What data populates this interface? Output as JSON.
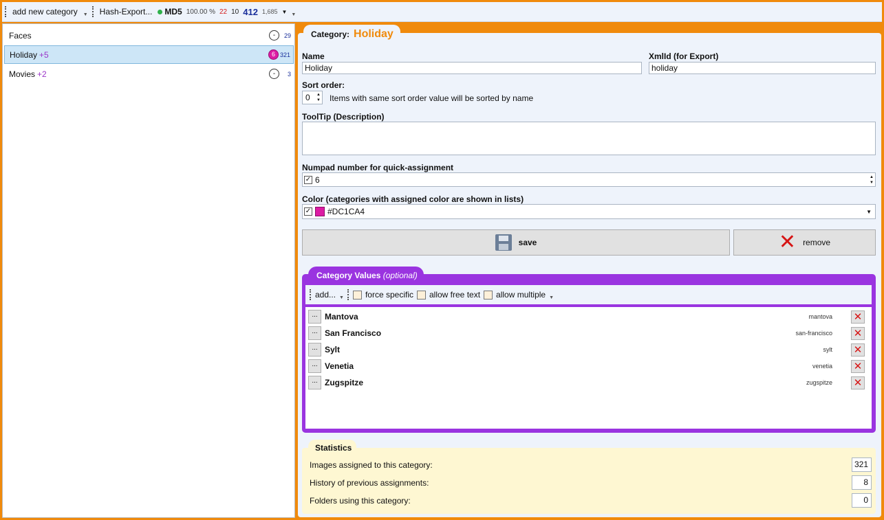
{
  "toolbar": {
    "add_category": "add new category",
    "hash_export": "Hash-Export...",
    "md5_label": "MD5",
    "percent": "100.00 %",
    "count_red": "22",
    "count_dark": "10",
    "count_blue": "412",
    "count_total": "1,685"
  },
  "categories": [
    {
      "name": "Faces",
      "plus": "",
      "badge": "-",
      "count": "29"
    },
    {
      "name": "Holiday",
      "plus": "+5",
      "badge": "6",
      "count": "321"
    },
    {
      "name": "Movies",
      "plus": "+2",
      "badge": "-",
      "count": "3"
    }
  ],
  "editor": {
    "tab_label": "Category:",
    "tab_value": "Holiday",
    "name_label": "Name",
    "name_value": "Holiday",
    "xmlid_label": "XmlId (for Export)",
    "xmlid_value": "holiday",
    "sort_label": "Sort order:",
    "sort_value": "0",
    "sort_hint": "Items with same sort order value will be sorted by name",
    "tooltip_label": "ToolTip (Description)",
    "numpad_label": "Numpad number for quick-assignment",
    "numpad_value": "6",
    "color_label": "Color (categories with assigned color are shown in lists)",
    "color_value": "#DC1CA4",
    "save_label": "save",
    "remove_label": "remove"
  },
  "category_values": {
    "title": "Category Values",
    "title_note": "(optional)",
    "add_label": "add...",
    "force_specific": "force specific",
    "allow_free_text": "allow free text",
    "allow_multiple": "allow multiple",
    "items": [
      {
        "name": "Mantova",
        "xml": "mantova"
      },
      {
        "name": "San Francisco",
        "xml": "san-francisco"
      },
      {
        "name": "Sylt",
        "xml": "sylt"
      },
      {
        "name": "Venetia",
        "xml": "venetia"
      },
      {
        "name": "Zugspitze",
        "xml": "zugspitze"
      }
    ]
  },
  "statistics": {
    "title": "Statistics",
    "rows": [
      {
        "label": "Images assigned to this category:",
        "value": "321"
      },
      {
        "label": "History of previous assignments:",
        "value": "8"
      },
      {
        "label": "Folders using this category:",
        "value": "0"
      }
    ]
  },
  "colors": {
    "accent": "#f08a0c",
    "values_frame": "#9a34e0",
    "category_color": "#DC1CA4"
  }
}
